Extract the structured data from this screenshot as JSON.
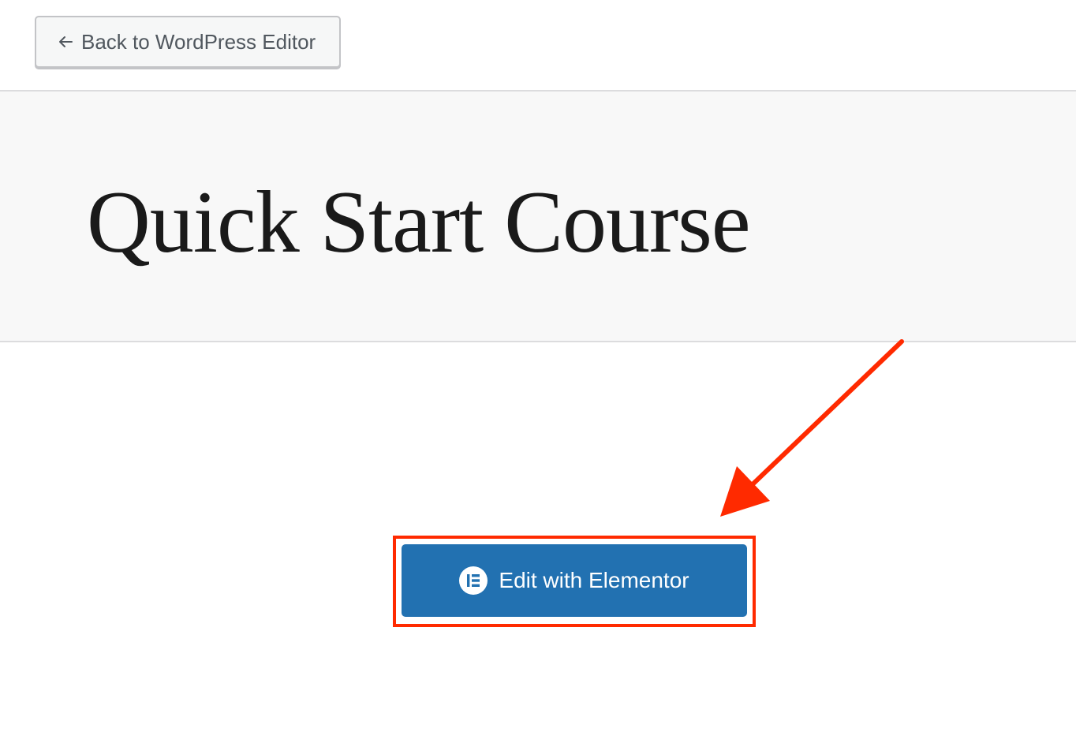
{
  "header": {
    "back_button_label": "Back to WordPress Editor",
    "back_icon": "arrow-left-icon"
  },
  "main": {
    "page_title": "Quick Start Course"
  },
  "elementor": {
    "button_label": "Edit with Elementor",
    "icon": "elementor-logo-icon",
    "button_color": "#2271b1"
  },
  "annotation": {
    "highlight_color": "#ff2a00",
    "arrow_color": "#ff2a00"
  }
}
